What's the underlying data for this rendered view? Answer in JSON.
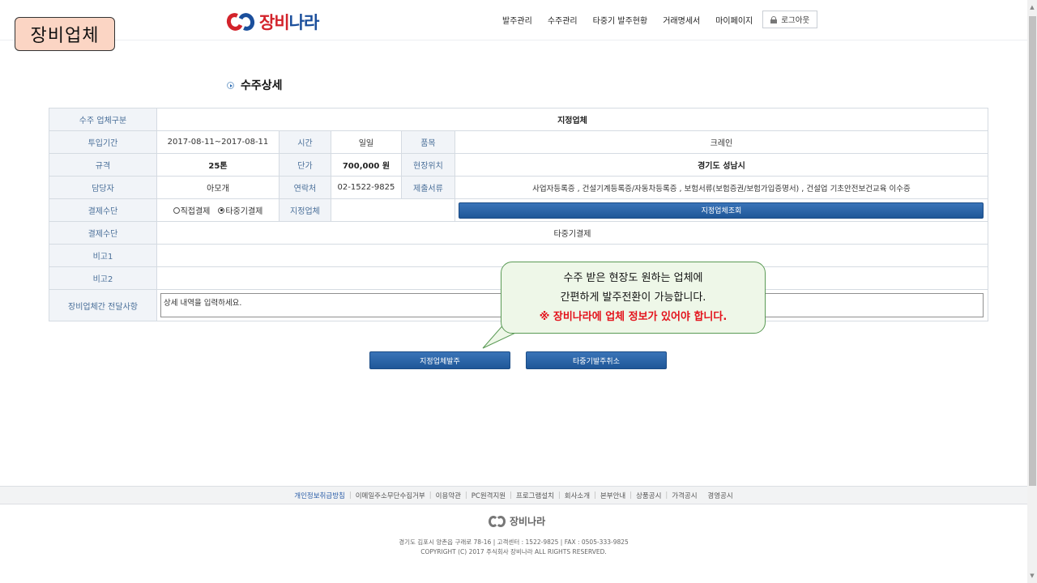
{
  "badge": "장비업체",
  "header": {
    "logo_text_a": "장비",
    "logo_text_b": "나라",
    "nav": [
      "발주관리",
      "수주관리",
      "타중기 발주현황",
      "거래명세서",
      "마이페이지"
    ],
    "logout": "로그아웃"
  },
  "section_title": "수주상세",
  "table": {
    "row1": {
      "label": "수주 업체구분",
      "value": "지정업체"
    },
    "row2": {
      "label": "투입기간",
      "period": "2017-08-11~2017-08-11",
      "time_label": "시간",
      "time_value": "일일",
      "item_label": "품목",
      "item_value": "크레인"
    },
    "row3": {
      "label": "규격",
      "spec": "25톤",
      "price_label": "단가",
      "price_value": "700,000 원",
      "site_label": "현장위치",
      "site_value": "경기도 성남시"
    },
    "row4": {
      "label": "담당자",
      "manager": "아모개",
      "contact_label": "연락처",
      "contact_value": "02-1522-9825",
      "docs_label": "제출서류",
      "docs_value": "사업자등록증 , 건설기계등록증/자동차등록증 , 보험서류(보험증권/보험가입증명서) , 건설업 기초안전보건교육 이수증"
    },
    "row5": {
      "label": "결제수단",
      "radio1": "직접결제",
      "radio2": "타중기결제",
      "vendor_label": "지정업체",
      "lookup_button": "지정업체조회"
    },
    "row6": {
      "label": "결제수단",
      "value": "타중기결제"
    },
    "row7": {
      "label": "비고1"
    },
    "row8": {
      "label": "비고2"
    },
    "row9": {
      "label": "장비업체간 전달사항",
      "memo": "상세 내역을 입력하세요."
    }
  },
  "actions": {
    "order_button": "지정업체발주",
    "cancel_button": "타중기발주취소"
  },
  "callout": {
    "line1": "수주 받은 현장도 원하는 업체에",
    "line2": "간편하게 발주전환이 가능합니다.",
    "line3": "※ 장비나라에 업체 정보가 있어야 합니다."
  },
  "footer": {
    "links": [
      "개인정보취급방침",
      "이메일주소무단수집거부",
      "이용약관",
      "PC원격지원",
      "프로그램설치",
      "회사소개",
      "본부안내",
      "상품공시",
      "가격공시",
      "경영공시"
    ],
    "logo_text": "장비나라",
    "address": "경기도 김포시 양촌읍 구래로 78-16  |  고객센터 : 1522-9825  |  FAX : 0505-333-9825",
    "copyright": "COPYRIGHT (C) 2017 주식회사 장비나라 ALL RIGHTS RESERVED."
  },
  "colors": {
    "accent_blue": "#1f5798",
    "logo_red": "#d3232b",
    "warn_red": "#e3121b",
    "callout_bg": "#eef7e8"
  }
}
